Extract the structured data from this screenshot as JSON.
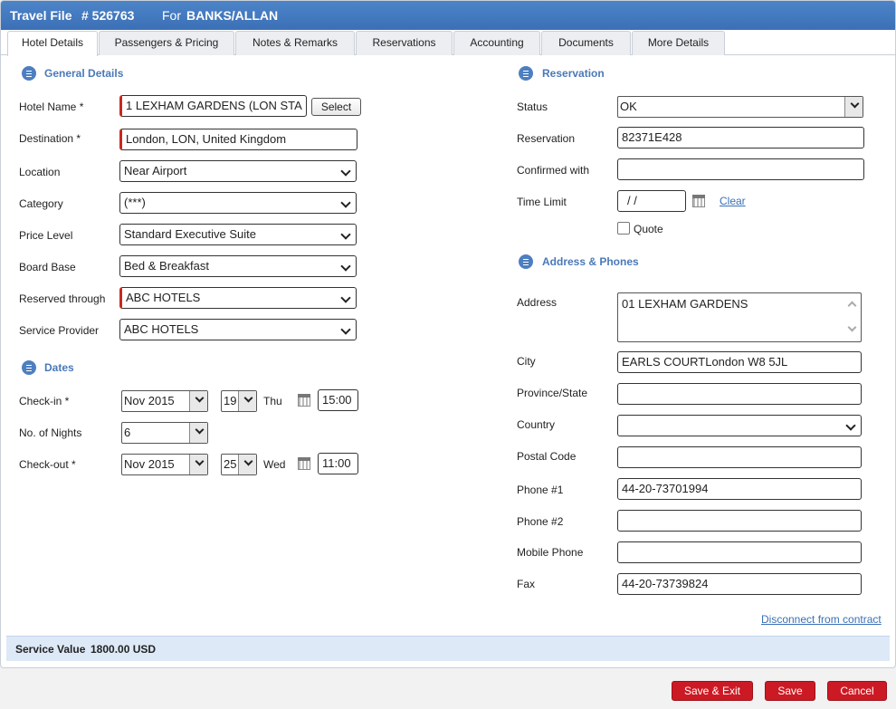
{
  "titlebar": {
    "file_label": "Travel File",
    "file_number": "# 526763",
    "for_label": "For",
    "client": "BANKS/ALLAN"
  },
  "tabs": [
    {
      "label": "Hotel Details"
    },
    {
      "label": "Passengers & Pricing"
    },
    {
      "label": "Notes & Remarks"
    },
    {
      "label": "Reservations"
    },
    {
      "label": "Accounting"
    },
    {
      "label": "Documents"
    },
    {
      "label": "More Details"
    }
  ],
  "general": {
    "title": "General Details",
    "hotel_name_label": "Hotel Name *",
    "hotel_name": "1 LEXHAM GARDENS (LON STA",
    "select_label": "Select",
    "destination_label": "Destination *",
    "destination": "London, LON, United Kingdom",
    "location_label": "Location",
    "location": "Near Airport",
    "category_label": "Category",
    "category": "(***)",
    "price_level_label": "Price Level",
    "price_level": "Standard Executive Suite",
    "board_base_label": "Board Base",
    "board_base": "Bed & Breakfast",
    "reserved_through_label": "Reserved through",
    "reserved_through": "ABC HOTELS",
    "service_provider_label": "Service Provider",
    "service_provider": "ABC HOTELS"
  },
  "dates": {
    "title": "Dates",
    "checkin_label": "Check-in *",
    "checkin_month": "Nov 2015",
    "checkin_day": "19",
    "checkin_weekday": "Thu",
    "checkin_time": "15:00",
    "nights_label": "No. of Nights",
    "nights": "6",
    "checkout_label": "Check-out *",
    "checkout_month": "Nov 2015",
    "checkout_day": "25",
    "checkout_weekday": "Wed",
    "checkout_time": "11:00"
  },
  "reservation": {
    "title": "Reservation",
    "status_label": "Status",
    "status": "OK",
    "reservation_label": "Reservation",
    "reservation": "82371E428",
    "confirmed_label": "Confirmed with",
    "confirmed": "",
    "time_limit_label": "Time Limit",
    "time_limit": "/ /",
    "clear_label": "Clear",
    "quote_label": "Quote"
  },
  "address": {
    "title": "Address & Phones",
    "address_label": "Address",
    "address": "01 LEXHAM GARDENS",
    "city_label": "City",
    "city": "EARLS COURTLondon W8 5JL",
    "province_label": "Province/State",
    "province": "",
    "country_label": "Country",
    "country": "",
    "postal_label": "Postal Code",
    "postal": "",
    "phone1_label": "Phone #1",
    "phone1": "44-20-73701994",
    "phone2_label": "Phone #2",
    "phone2": "",
    "mobile_label": "Mobile Phone",
    "mobile": "",
    "fax_label": "Fax",
    "fax": "44-20-73739824"
  },
  "disconnect_label": "Disconnect from contract",
  "service_value": {
    "label": "Service Value",
    "value": "1800.00 USD"
  },
  "footer": {
    "save_exit": "Save & Exit",
    "save": "Save",
    "cancel": "Cancel"
  },
  "colors": {
    "accent": "#3b70b6",
    "danger": "#cc1a24",
    "required": "#c8281e"
  }
}
